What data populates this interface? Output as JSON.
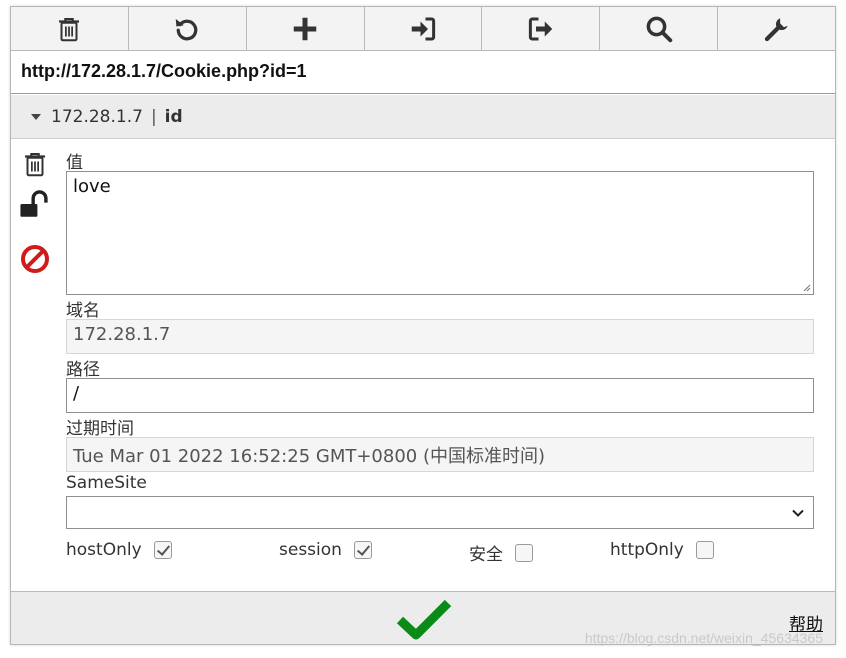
{
  "toolbar": {
    "buttons": [
      {
        "icon": "trash-icon"
      },
      {
        "icon": "undo-icon"
      },
      {
        "icon": "plus-icon"
      },
      {
        "icon": "import-icon"
      },
      {
        "icon": "export-icon"
      },
      {
        "icon": "search-icon"
      },
      {
        "icon": "wrench-icon"
      }
    ]
  },
  "url": "http://172.28.1.7/Cookie.php?id=1",
  "cookie": {
    "host": "172.28.1.7",
    "separator": "|",
    "name": "id"
  },
  "fields": {
    "value_label": "值",
    "value": "love",
    "domain_label": "域名",
    "domain": "172.28.1.7",
    "path_label": "路径",
    "path": "/",
    "expires_label": "过期时间",
    "expires": "Tue Mar 01 2022 16:52:25 GMT+0800 (中国标准时间)",
    "samesite_label": "SameSite",
    "samesite_value": ""
  },
  "flags": {
    "hostOnly_label": "hostOnly",
    "hostOnly": true,
    "session_label": "session",
    "session": true,
    "secure_label": "安全",
    "secure": false,
    "httpOnly_label": "httpOnly",
    "httpOnly": false
  },
  "footer": {
    "help_label": "帮助",
    "watermark": "https://blog.csdn.net/weixin_45634365"
  },
  "colors": {
    "ok_green": "#0a8a17",
    "block_red": "#d11a1a",
    "icon_dark": "#333333"
  }
}
